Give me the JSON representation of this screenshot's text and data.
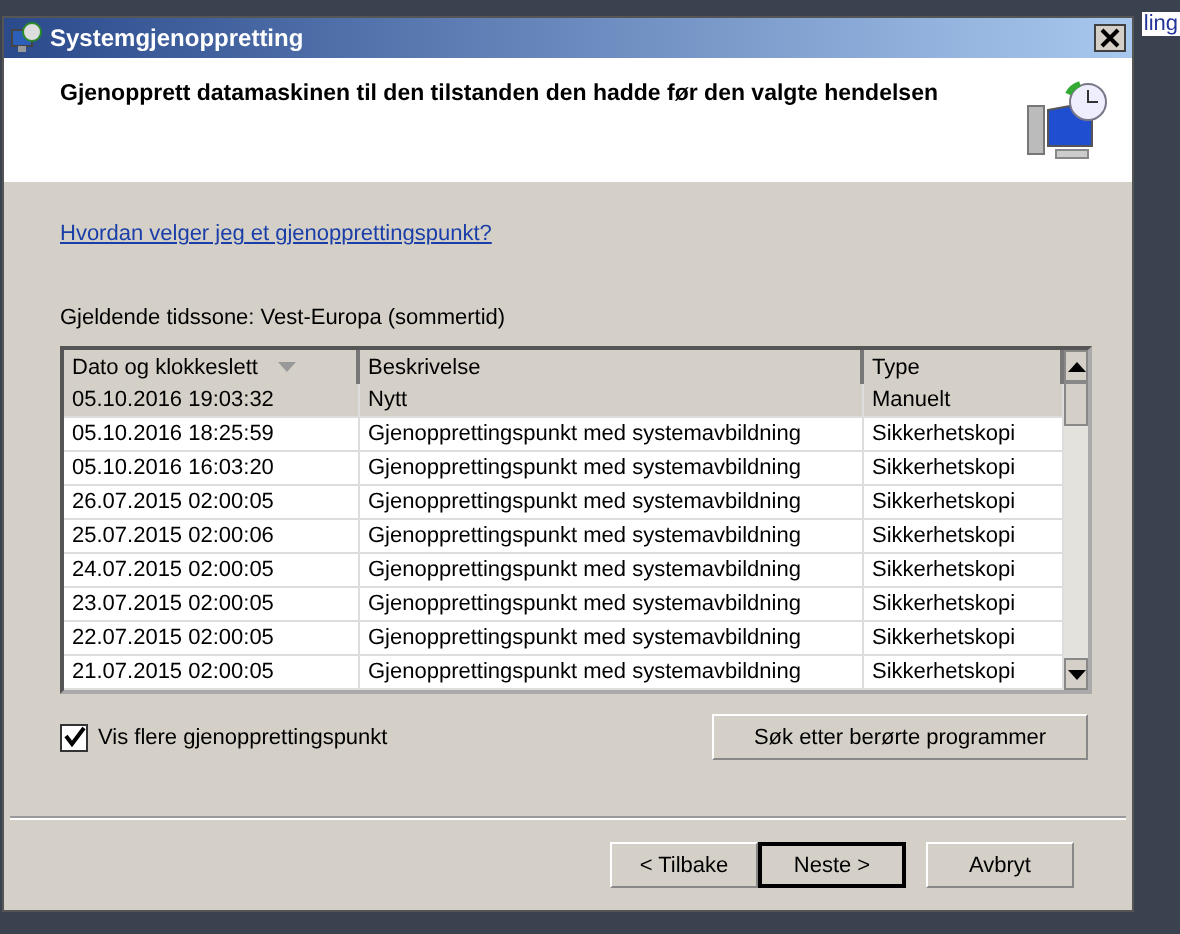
{
  "window": {
    "title": "Systemgjenoppretting"
  },
  "background_text": "ling",
  "heading": "Gjenopprett datamaskinen til den tilstanden den hadde før den valgte hendelsen",
  "help_link": "Hvordan velger jeg et gjenopprettingspunkt?",
  "timezone": "Gjeldende tidssone: Vest-Europa (sommertid)",
  "table": {
    "columns": [
      "Dato og klokkeslett",
      "Beskrivelse",
      "Type"
    ],
    "rows": [
      {
        "date": "05.10.2016 19:03:32",
        "description": "Nytt",
        "type": "Manuelt",
        "selected": true
      },
      {
        "date": "05.10.2016 18:25:59",
        "description": "Gjenopprettingspunkt med systemavbildning",
        "type": "Sikkerhetskopi",
        "selected": false
      },
      {
        "date": "05.10.2016 16:03:20",
        "description": "Gjenopprettingspunkt med systemavbildning",
        "type": "Sikkerhetskopi",
        "selected": false
      },
      {
        "date": "26.07.2015 02:00:05",
        "description": "Gjenopprettingspunkt med systemavbildning",
        "type": "Sikkerhetskopi",
        "selected": false
      },
      {
        "date": "25.07.2015 02:00:06",
        "description": "Gjenopprettingspunkt med systemavbildning",
        "type": "Sikkerhetskopi",
        "selected": false
      },
      {
        "date": "24.07.2015 02:00:05",
        "description": "Gjenopprettingspunkt med systemavbildning",
        "type": "Sikkerhetskopi",
        "selected": false
      },
      {
        "date": "23.07.2015 02:00:05",
        "description": "Gjenopprettingspunkt med systemavbildning",
        "type": "Sikkerhetskopi",
        "selected": false
      },
      {
        "date": "22.07.2015 02:00:05",
        "description": "Gjenopprettingspunkt med systemavbildning",
        "type": "Sikkerhetskopi",
        "selected": false
      },
      {
        "date": "21.07.2015 02:00:05",
        "description": "Gjenopprettingspunkt med systemavbildning",
        "type": "Sikkerhetskopi",
        "selected": false
      }
    ]
  },
  "show_more": {
    "label": "Vis flere gjenopprettingspunkt",
    "checked": true
  },
  "scan_button": "Søk etter berørte programmer",
  "buttons": [
    {
      "label": "< Tilbake",
      "default": false
    },
    {
      "label": "Neste >",
      "default": true
    },
    {
      "label": "Avbryt",
      "default": false
    }
  ]
}
